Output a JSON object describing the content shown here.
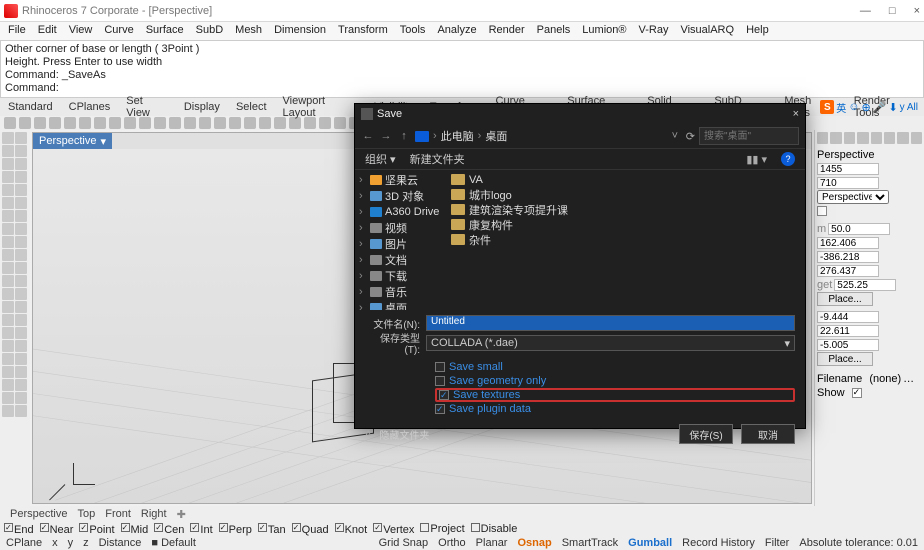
{
  "titlebar": {
    "text": "Rhinoceros 7 Corporate - [Perspective]"
  },
  "menu": [
    "File",
    "Edit",
    "View",
    "Curve",
    "Surface",
    "SubD",
    "Mesh",
    "Dimension",
    "Transform",
    "Tools",
    "Analyze",
    "Render",
    "Panels",
    "Lumion®",
    "V-Ray",
    "VisualARQ",
    "Help"
  ],
  "cmd": {
    "l1": "Other corner of base or length ( 3Point )",
    "l2": "Height. Press Enter to use width",
    "l3": "Command: _SaveAs",
    "l4": "Command:"
  },
  "tabs": [
    "Standard",
    "CPlanes",
    "Set View",
    "Display",
    "Select",
    "Viewport Layout",
    "Visibility",
    "Transform",
    "Curve Tools",
    "Surface Tools",
    "Solid Tools",
    "SubD Tools",
    "Mesh Tools",
    "Render Tools"
  ],
  "pinyin": {
    "badge": "S",
    "text1": "英",
    "text2": "y All"
  },
  "viewport": {
    "tab": "Perspective"
  },
  "rpanel": {
    "persp": "Perspective",
    "v1": "1455",
    "v2": "710",
    "drop": "Perspective",
    "v3": "50.0",
    "v4": "162.406",
    "v5": "-386.218",
    "v6": "276.437",
    "getlbl": "get",
    "v7": "525.25",
    "place": "Place...",
    "v8": "-9.444",
    "v9": "22.611",
    "v10": "-5.005",
    "place2": "Place...",
    "fn_lbl": "Filename",
    "fn_val": "(none)",
    "show": "Show",
    "m_lbl": "m"
  },
  "vp_bottom": [
    "Perspective",
    "Top",
    "Front",
    "Right"
  ],
  "osnap": [
    {
      "l": "End",
      "c": true
    },
    {
      "l": "Near",
      "c": true
    },
    {
      "l": "Point",
      "c": true
    },
    {
      "l": "Mid",
      "c": true
    },
    {
      "l": "Cen",
      "c": true
    },
    {
      "l": "Int",
      "c": true
    },
    {
      "l": "Perp",
      "c": true
    },
    {
      "l": "Tan",
      "c": true
    },
    {
      "l": "Quad",
      "c": true
    },
    {
      "l": "Knot",
      "c": true
    },
    {
      "l": "Vertex",
      "c": true
    },
    {
      "l": "Project",
      "c": false
    },
    {
      "l": "Disable",
      "c": false
    }
  ],
  "status": {
    "cplane": "CPlane",
    "x": "x",
    "y": "y",
    "z": "z",
    "dist": "Distance",
    "def": "■ Default",
    "gs": "Grid Snap",
    "ortho": "Ortho",
    "planar": "Planar",
    "osnap": "Osnap",
    "st": "SmartTrack",
    "gum": "Gumball",
    "rh": "Record History",
    "filt": "Filter",
    "tol": "Absolute tolerance: 0.01"
  },
  "dlg": {
    "title": "Save",
    "crumb1": "此电脑",
    "crumb2": "桌面",
    "search_ph": "搜索\"桌面\"",
    "org": "组织",
    "new": "新建文件夹",
    "tree": [
      {
        "t": "坚果云",
        "c": "cloud"
      },
      {
        "t": "3D 对象",
        "c": "desk"
      },
      {
        "t": "A360 Drive",
        "c": "a360"
      },
      {
        "t": "视频",
        "c": "vid"
      },
      {
        "t": "图片",
        "c": "pic"
      },
      {
        "t": "文档",
        "c": "doc"
      },
      {
        "t": "下载",
        "c": "dl"
      },
      {
        "t": "音乐",
        "c": "mus"
      },
      {
        "t": "桌面",
        "c": "desk"
      }
    ],
    "list": [
      "VA",
      "城市logo",
      "建筑渲染专项提升课",
      "康复构件",
      "杂件"
    ],
    "fn_lbl": "文件名(N):",
    "fn_val": "Untitled",
    "type_lbl": "保存类型(T):",
    "type_val": "COLLADA (*.dae)",
    "opts": [
      {
        "l": "Save small",
        "c": false
      },
      {
        "l": "Save geometry only",
        "c": false
      },
      {
        "l": "Save textures",
        "c": true,
        "hl": true
      },
      {
        "l": "Save plugin data",
        "c": true
      }
    ],
    "hide": "隐藏文件夹",
    "save": "保存(S)",
    "cancel": "取消"
  }
}
